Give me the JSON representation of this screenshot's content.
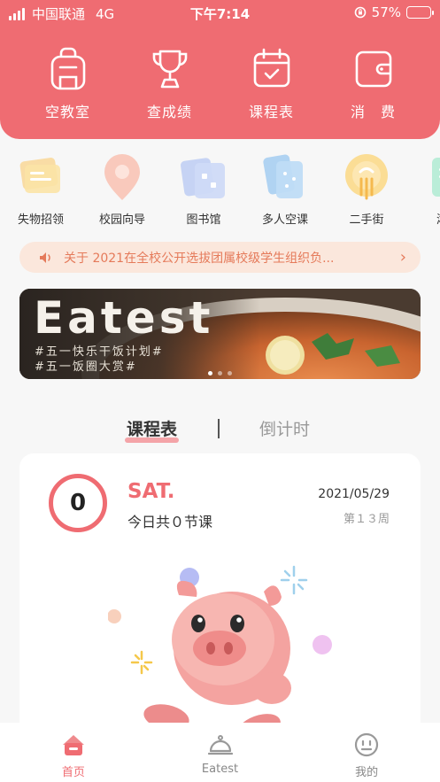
{
  "status_bar": {
    "carrier": "中国联通",
    "network": "4G",
    "time": "下午7:14",
    "battery": "57%",
    "battery_level": 0.57
  },
  "quick_actions": [
    {
      "label": "空教室",
      "icon": "backpack-icon"
    },
    {
      "label": "查成绩",
      "icon": "trophy-icon"
    },
    {
      "label": "课程表",
      "icon": "calendar-icon"
    },
    {
      "label": "消　费",
      "icon": "wallet-icon"
    }
  ],
  "categories": [
    {
      "label": "失物招领",
      "icon": "lost-found-icon"
    },
    {
      "label": "校园向导",
      "icon": "map-pin-icon"
    },
    {
      "label": "图书馆",
      "icon": "library-icon"
    },
    {
      "label": "多人空课",
      "icon": "cards-icon"
    },
    {
      "label": "二手街",
      "icon": "secondhand-icon"
    },
    {
      "label": "湘大",
      "icon": "xiangda-icon"
    }
  ],
  "notice": {
    "text": "关于 2021在全校公开选拔团属校级学生组织负..."
  },
  "banner": {
    "title": "Eatest",
    "line1": "#五一快乐干饭计划#",
    "line2": "#五一饭圈大赏#"
  },
  "tabs": {
    "active": "课程表",
    "inactive": "倒计时"
  },
  "schedule": {
    "count": "0",
    "day": "SAT.",
    "summary": "今日共０节课",
    "date": "2021/05/29",
    "week": "第１３周"
  },
  "bottom_nav": [
    {
      "label": "首页",
      "icon": "home-icon",
      "active": true
    },
    {
      "label": "Eatest",
      "icon": "food-cloche-icon",
      "active": false
    },
    {
      "label": "我的",
      "icon": "smiley-icon",
      "active": false
    }
  ],
  "colors": {
    "primary": "#ef6c72",
    "notice_bg": "#fbe7dc",
    "notice_text": "#e57a5a"
  }
}
